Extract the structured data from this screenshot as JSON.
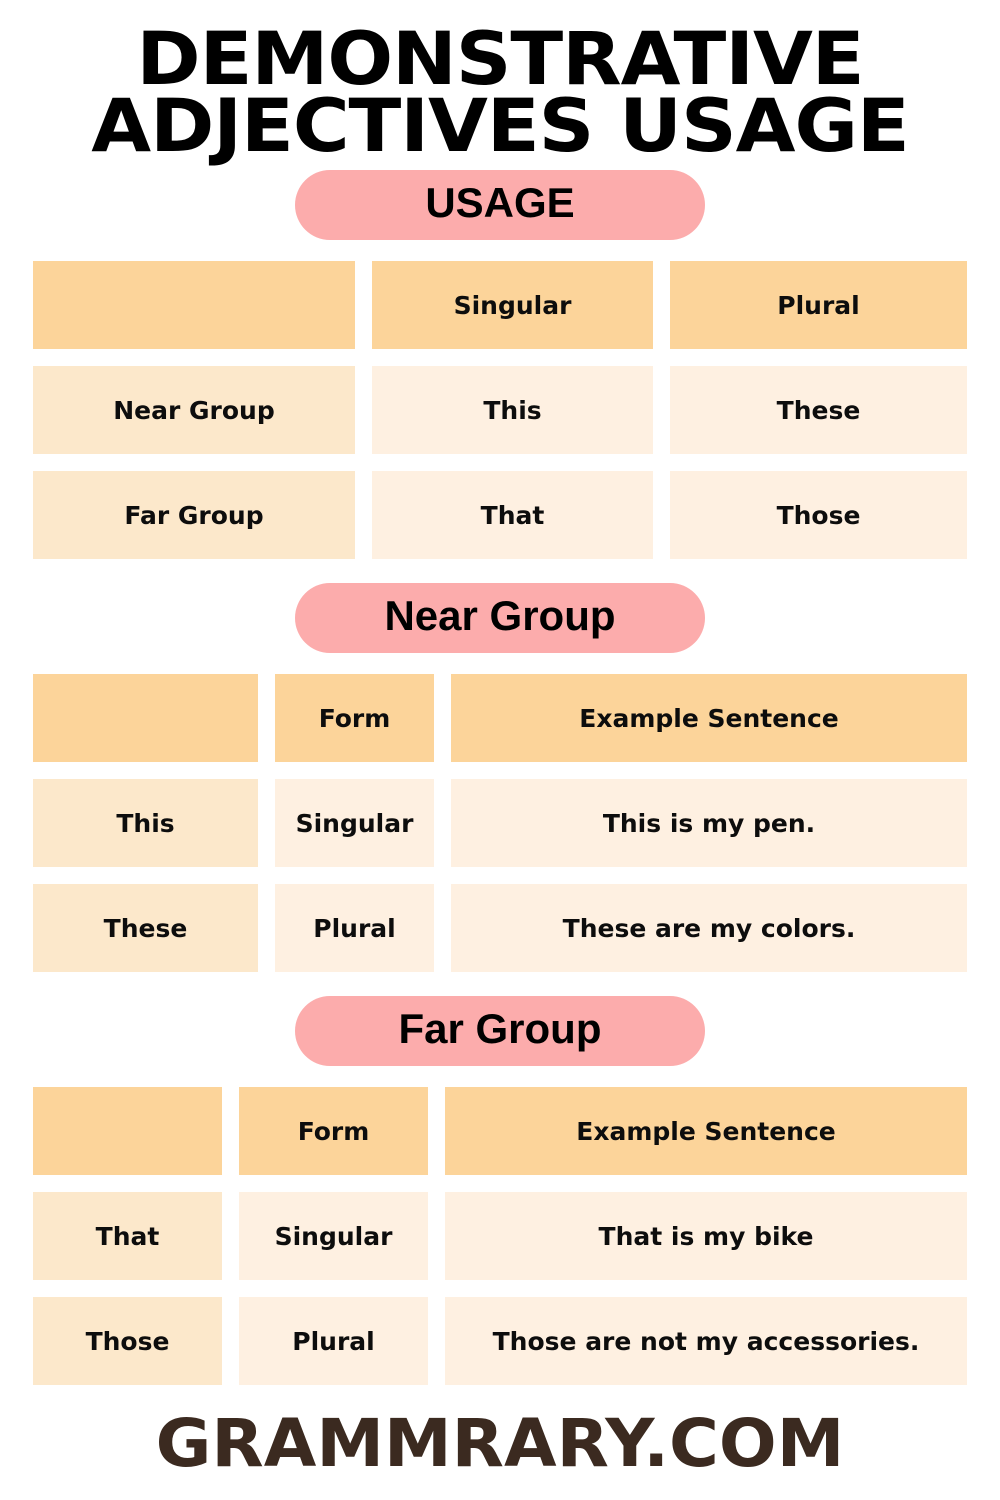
{
  "title": {
    "line1": "DEMONSTRATIVE",
    "line2": "ADJECTIVES USAGE"
  },
  "colors": {
    "banner_pink": "#FCACAC",
    "header_orange": "#FCD49A",
    "row_cream_dark": "#FCE8CB",
    "row_cream_light": "#FEF0E1",
    "title_black": "#000000",
    "footer_brown": "#3B2A20",
    "background": "#FFFFFF"
  },
  "sections": [
    {
      "banner": "USAGE",
      "table": {
        "header": [
          "",
          "Singular",
          "Plural"
        ],
        "rows": [
          [
            "Near Group",
            "This",
            "These"
          ],
          [
            "Far Group",
            "That",
            "Those"
          ]
        ]
      }
    },
    {
      "banner": "Near Group",
      "table": {
        "header": [
          "",
          "Form",
          "Example Sentence"
        ],
        "rows": [
          [
            "This",
            "Singular",
            "This is my pen."
          ],
          [
            "These",
            "Plural",
            "These are my colors."
          ]
        ]
      }
    },
    {
      "banner": "Far Group",
      "table": {
        "header": [
          "",
          "Form",
          "Example Sentence"
        ],
        "rows": [
          [
            "That",
            "Singular",
            "That is my bike"
          ],
          [
            "Those",
            "Plural",
            "Those are not my accessories."
          ]
        ]
      }
    }
  ],
  "footer": {
    "text": "GRAMMRARY.COM"
  }
}
